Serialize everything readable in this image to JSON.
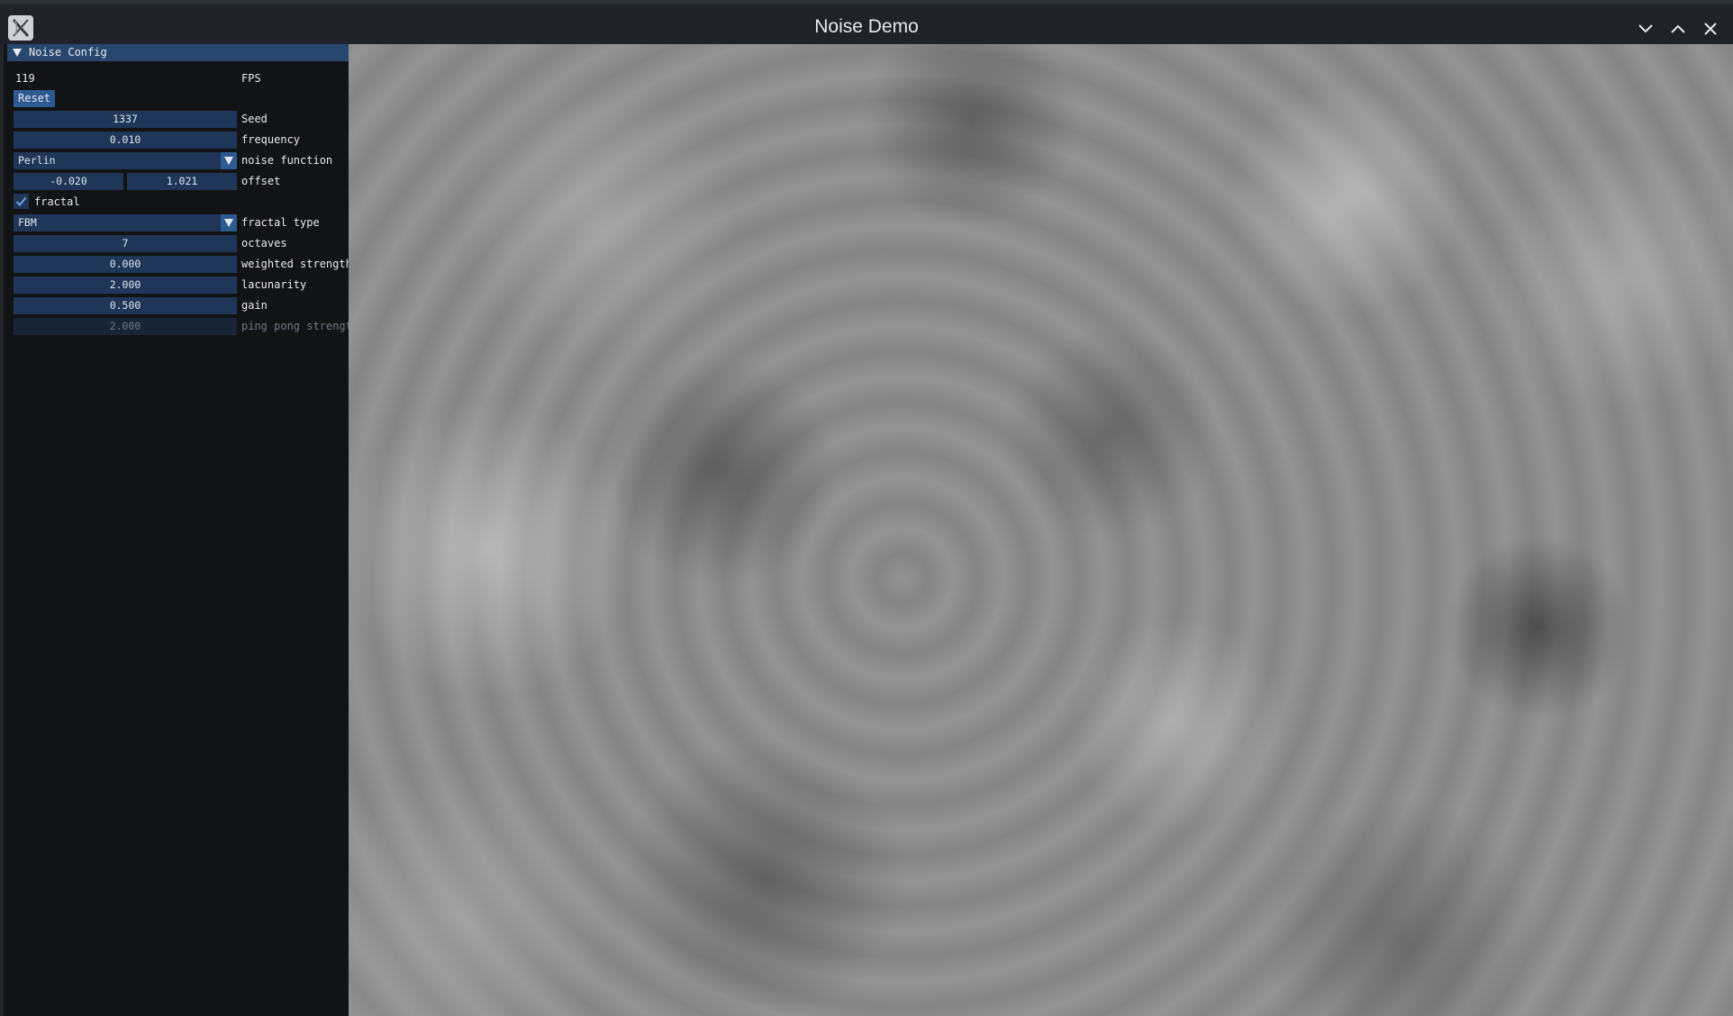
{
  "window": {
    "title": "Noise Demo",
    "icons": [
      "app-x-logo-icon",
      "minimize-chevron-down-icon",
      "maximize-chevron-up-icon",
      "close-icon"
    ]
  },
  "panel": {
    "header": "Noise Config",
    "fps_value": "119",
    "fps_label": "FPS",
    "reset_label": "Reset",
    "seed": {
      "value": "1337",
      "label": "Seed"
    },
    "frequency": {
      "value": "0.010",
      "label": "frequency"
    },
    "noise_function": {
      "value": "Perlin",
      "label": "noise function"
    },
    "offset": {
      "x": "-0.020",
      "y": "1.021",
      "label": "offset"
    },
    "fractal": {
      "checked": true,
      "label": "fractal"
    },
    "fractal_type": {
      "value": "FBM",
      "label": "fractal type"
    },
    "octaves": {
      "value": "7",
      "label": "octaves"
    },
    "weighted_strength": {
      "value": "0.000",
      "label": "weighted strength"
    },
    "lacunarity": {
      "value": "2.000",
      "label": "lacunarity"
    },
    "gain": {
      "value": "0.500",
      "label": "gain"
    },
    "ping_pong_strength": {
      "value": "2.000",
      "label": "ping pong strength",
      "disabled": true
    }
  },
  "colors": {
    "titlebar": "#1f2329",
    "panel_bg": "#121315",
    "header_bg": "#28476e",
    "field_bg": "#1f3658",
    "accent": "#2e5a92"
  }
}
